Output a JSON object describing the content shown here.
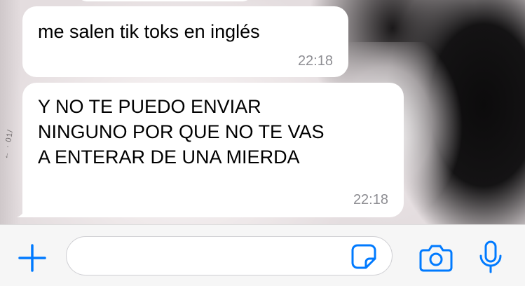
{
  "wallpaper": {
    "visible_text": "← · 01/"
  },
  "messages": [
    {
      "text": "me salen tik toks en inglés",
      "time": "22:18"
    },
    {
      "text": "Y NO TE PUEDO ENVIAR\nNINGUNO POR QUE NO TE VAS\nA ENTERAR DE UNA MIERDA",
      "time": "22:18"
    }
  ],
  "composer": {
    "input_value": "",
    "placeholder": "",
    "icons": {
      "attach": "plus-icon",
      "sticker": "sticker-icon",
      "camera": "camera-icon",
      "mic": "microphone-icon"
    }
  },
  "colors": {
    "accent": "#007aff",
    "bubble_bg": "#ffffff",
    "time_text": "#8e8e93",
    "bar_bg": "#f6f6f6"
  }
}
